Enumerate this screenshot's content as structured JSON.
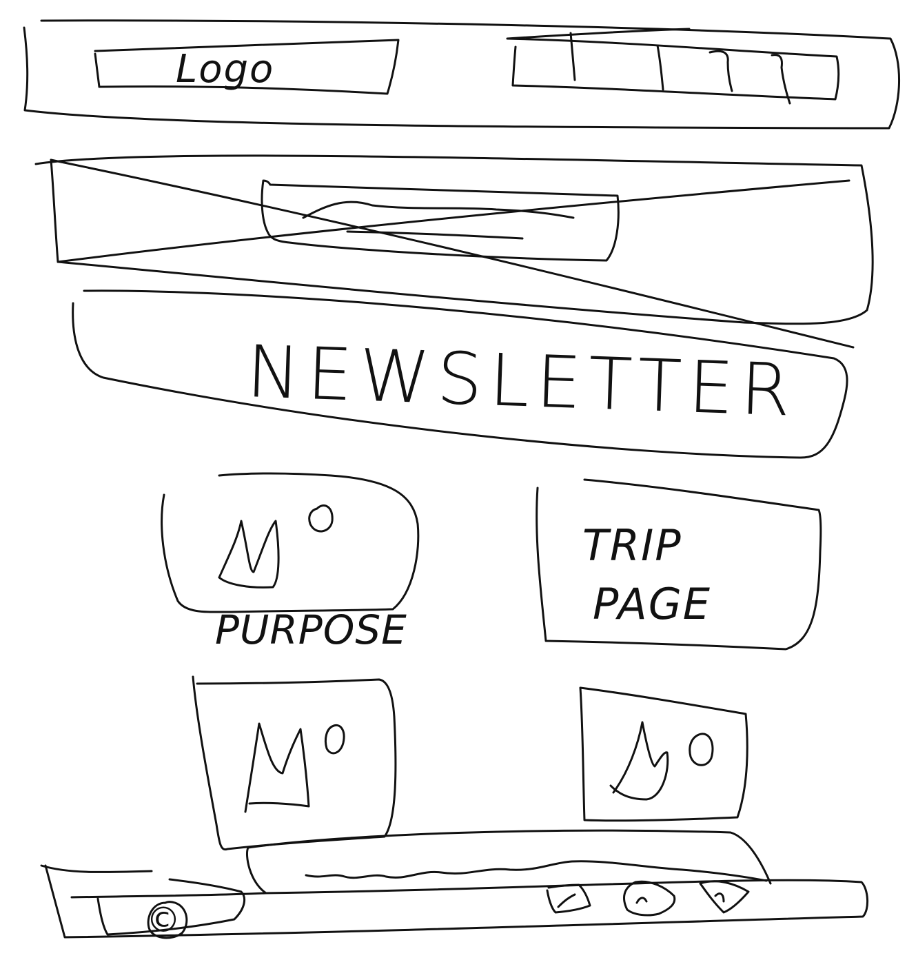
{
  "colors": {
    "ink": "#111111",
    "paper": "#ffffff"
  },
  "header": {
    "logo_label": "Logo",
    "nav_item_count": 4
  },
  "hero": {
    "placeholder": "image-placeholder-x"
  },
  "newsletter": {
    "label": "NEWSLETTER"
  },
  "tiles": [
    {
      "kind": "image",
      "icon": "mountain-sun-icon",
      "caption": "PURPOSE"
    },
    {
      "kind": "text",
      "title": "TRIP",
      "subtitle": "PAGE"
    },
    {
      "kind": "image",
      "icon": "mountain-sun-icon"
    },
    {
      "kind": "image",
      "icon": "mountain-sun-icon"
    }
  ],
  "footer": {
    "copyright": "©",
    "social_icons": [
      "social-icon-1",
      "social-icon-2",
      "social-icon-3"
    ]
  }
}
